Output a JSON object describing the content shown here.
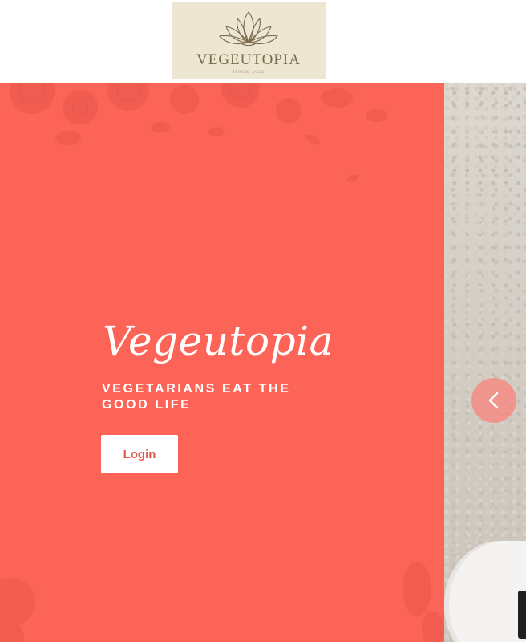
{
  "brand": {
    "logo_text": "VEGEUTOPIA",
    "logo_tagline": "SINCE 2022"
  },
  "hero": {
    "title": "Vegeutopia",
    "subtitle": "VEGETARIANS EAT THE GOOD LIFE",
    "login_label": "Login"
  },
  "icons": {
    "logo": "lotus-icon",
    "carousel_prev": "chevron-left-icon"
  },
  "colors": {
    "hero_background": "#fb6457",
    "logo_background": "#ece6d2",
    "logo_ink": "#7a6a4a",
    "button_text": "#e8574b",
    "carousel_button": "#f48c84"
  }
}
